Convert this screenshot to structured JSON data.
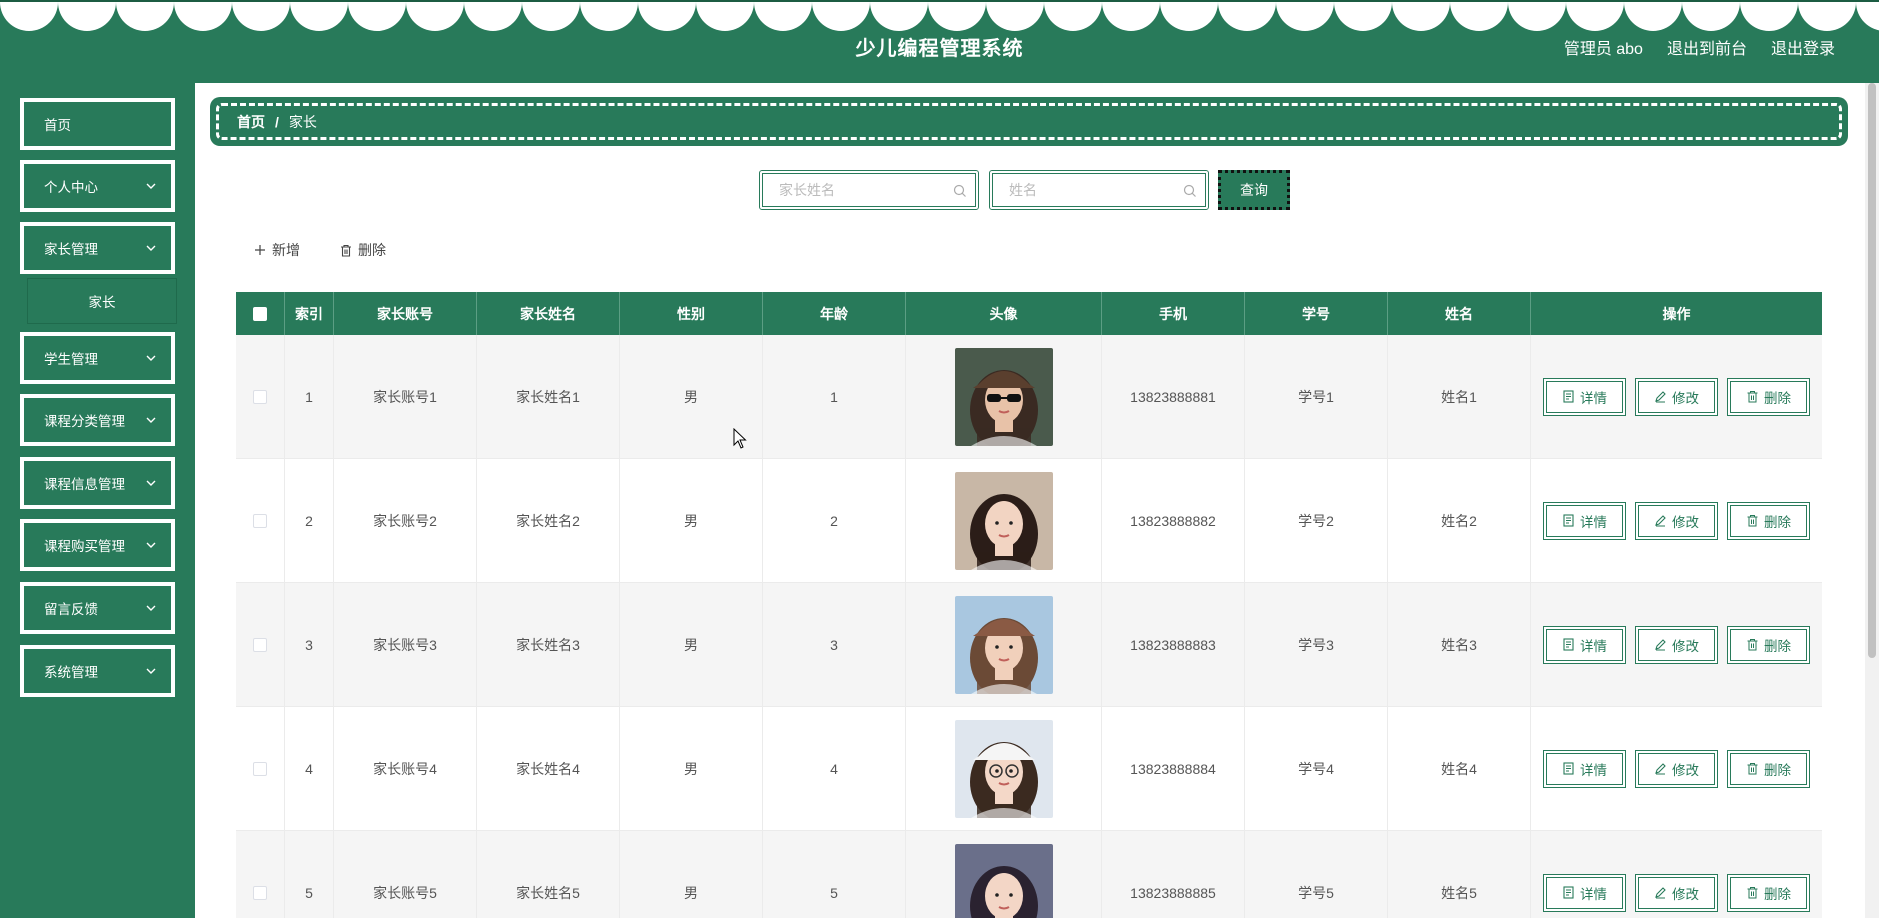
{
  "header": {
    "title": "少儿编程管理系统",
    "admin_label": "管理员 abo",
    "to_front_label": "退出到前台",
    "logout_label": "退出登录"
  },
  "sidebar": {
    "items": [
      {
        "label": "首页",
        "has_chevron": false
      },
      {
        "label": "个人中心",
        "has_chevron": true
      },
      {
        "label": "家长管理",
        "has_chevron": true
      },
      {
        "label": "学生管理",
        "has_chevron": true
      },
      {
        "label": "课程分类管理",
        "has_chevron": true
      },
      {
        "label": "课程信息管理",
        "has_chevron": true
      },
      {
        "label": "课程购买管理",
        "has_chevron": true
      },
      {
        "label": "留言反馈",
        "has_chevron": true
      },
      {
        "label": "系统管理",
        "has_chevron": true
      }
    ],
    "submenu": {
      "label": "家长"
    }
  },
  "breadcrumb": {
    "home": "首页",
    "separator": "/",
    "current": "家长"
  },
  "search": {
    "parent_name_placeholder": "家长姓名",
    "name_placeholder": "姓名",
    "query_label": "查询"
  },
  "actions": {
    "add_label": "新增",
    "delete_label": "删除"
  },
  "table": {
    "columns": [
      "索引",
      "家长账号",
      "家长姓名",
      "性别",
      "年龄",
      "头像",
      "手机",
      "学号",
      "姓名",
      "操作"
    ],
    "op_labels": {
      "detail": "详情",
      "edit": "修改",
      "delete": "删除"
    },
    "rows": [
      {
        "index": "1",
        "account": "家长账号1",
        "parent_name": "家长姓名1",
        "gender": "男",
        "age": "1",
        "phone": "13823888881",
        "student_no": "学号1",
        "name": "姓名1"
      },
      {
        "index": "2",
        "account": "家长账号2",
        "parent_name": "家长姓名2",
        "gender": "男",
        "age": "2",
        "phone": "13823888882",
        "student_no": "学号2",
        "name": "姓名2"
      },
      {
        "index": "3",
        "account": "家长账号3",
        "parent_name": "家长姓名3",
        "gender": "男",
        "age": "3",
        "phone": "13823888883",
        "student_no": "学号3",
        "name": "姓名3"
      },
      {
        "index": "4",
        "account": "家长账号4",
        "parent_name": "家长姓名4",
        "gender": "男",
        "age": "4",
        "phone": "13823888884",
        "student_no": "学号4",
        "name": "姓名4"
      },
      {
        "index": "5",
        "account": "家长账号5",
        "parent_name": "家长姓名5",
        "gender": "男",
        "age": "5",
        "phone": "13823888885",
        "student_no": "学号5",
        "name": "姓名5"
      }
    ]
  },
  "colors": {
    "primary": "#287a5a",
    "white": "#ffffff",
    "row_stripe": "#f5f5f5"
  }
}
